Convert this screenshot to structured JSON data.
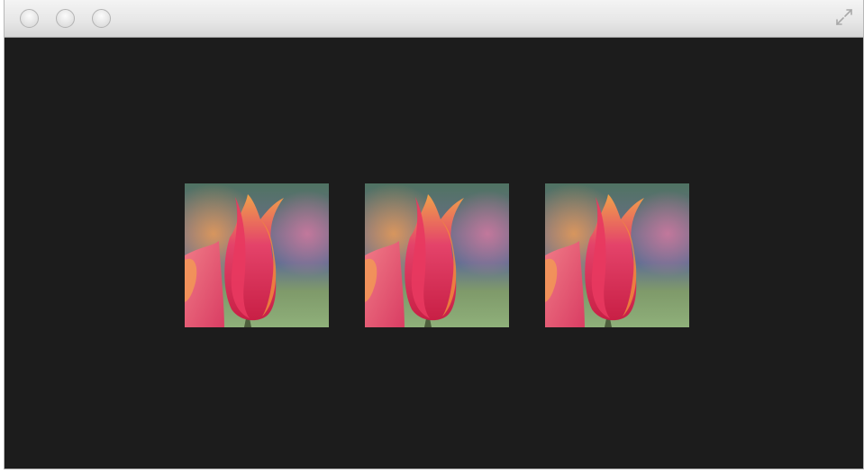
{
  "window": {
    "controls": {
      "close_icon": "close-icon",
      "minimize_icon": "minimize-icon",
      "zoom_icon": "zoom-icon",
      "fullscreen_icon": "fullscreen-icon"
    },
    "background_color": "#1c1c1c"
  },
  "gallery": {
    "images": [
      {
        "subject": "tulip-image"
      },
      {
        "subject": "tulip-image"
      },
      {
        "subject": "tulip-image"
      }
    ]
  }
}
